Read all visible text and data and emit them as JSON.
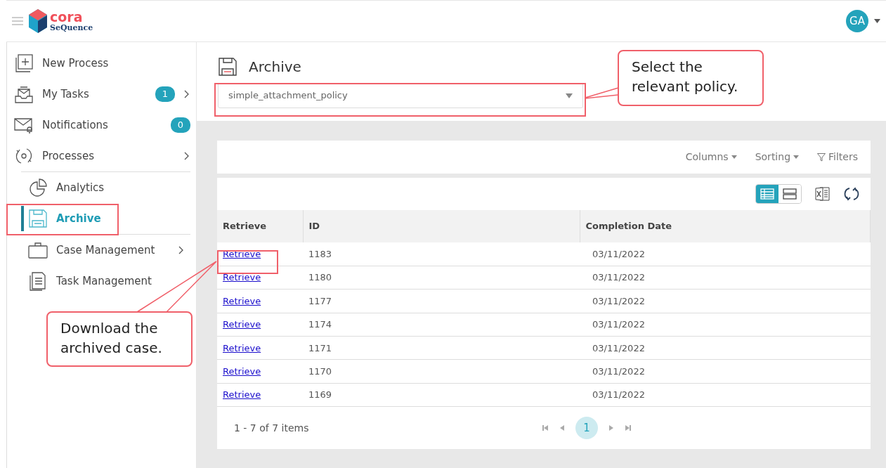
{
  "header": {
    "logo_top": "cora",
    "logo_bottom": "SeQuence",
    "avatar": "GA"
  },
  "sidebar": {
    "groups": [
      [
        {
          "label": "New Process",
          "has_submenu": false,
          "selected": false
        },
        {
          "label": "My Tasks",
          "badge": "1",
          "has_submenu": true,
          "selected": false
        },
        {
          "label": "Notifications",
          "badge": "0",
          "has_submenu": false,
          "selected": false
        },
        {
          "label": "Processes",
          "has_submenu": true,
          "selected": false
        }
      ],
      [
        {
          "label": "Analytics",
          "has_submenu": false,
          "selected": false
        },
        {
          "label": "Archive",
          "has_submenu": false,
          "selected": true
        }
      ],
      [
        {
          "label": "Case Management",
          "has_submenu": true,
          "selected": false
        },
        {
          "label": "Task Management",
          "has_submenu": false,
          "selected": false
        }
      ]
    ]
  },
  "page": {
    "title": "Archive",
    "policy": "simple_attachment_policy"
  },
  "toolbar": {
    "columns": "Columns",
    "sorting": "Sorting",
    "filters": "Filters"
  },
  "views": [
    {
      "kind": "grid",
      "selected": true
    },
    {
      "kind": "list",
      "selected": false
    }
  ],
  "table": {
    "columns": [
      "Retrieve",
      "ID",
      "Completion Date"
    ],
    "rows": [
      {
        "link": "Retrieve",
        "id": "1183",
        "date": "03/11/2022"
      },
      {
        "link": "Retrieve",
        "id": "1180",
        "date": "03/11/2022"
      },
      {
        "link": "Retrieve",
        "id": "1177",
        "date": "03/11/2022"
      },
      {
        "link": "Retrieve",
        "id": "1174",
        "date": "03/11/2022"
      },
      {
        "link": "Retrieve",
        "id": "1171",
        "date": "03/11/2022"
      },
      {
        "link": "Retrieve",
        "id": "1170",
        "date": "03/11/2022"
      },
      {
        "link": "Retrieve",
        "id": "1169",
        "date": "03/11/2022"
      }
    ]
  },
  "pager": {
    "summary": "1 - 7 of 7 items",
    "pages": [
      {
        "label": "1",
        "selected": true
      }
    ]
  },
  "annotations": [
    {
      "text": "Select the relevant policy."
    },
    {
      "text": "Download the archived case."
    }
  ]
}
